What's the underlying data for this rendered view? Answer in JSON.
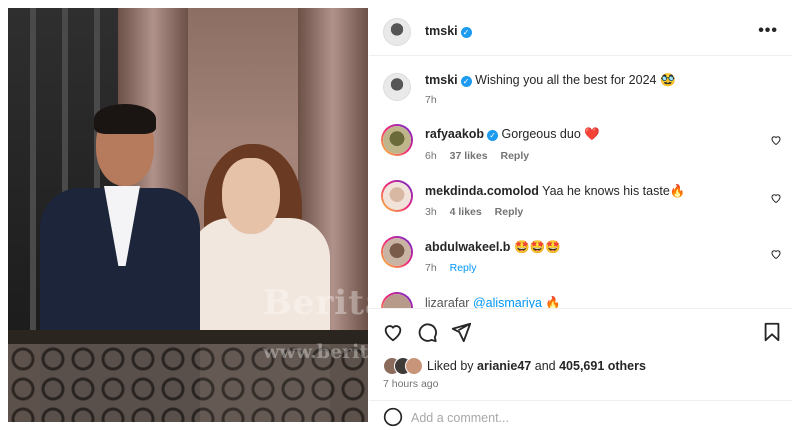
{
  "post": {
    "author": "tmski",
    "verified": true
  },
  "caption": {
    "username": "tmski",
    "text": "Wishing you all the best for 2024",
    "emoji": "🥸",
    "time": "7h"
  },
  "comments": [
    {
      "username": "rafyaakob",
      "verified": true,
      "text": "Gorgeous duo",
      "emoji": "❤️",
      "time": "6h",
      "likes": "37 likes",
      "reply": "Reply"
    },
    {
      "username": "mekdinda.comolod",
      "verified": false,
      "text": "Yaa he knows his taste",
      "emoji": "🔥",
      "time": "3h",
      "likes": "4 likes",
      "reply": "Reply"
    },
    {
      "username": "abdulwakeel.b",
      "verified": false,
      "text": "",
      "emoji": "🤩🤩🤩",
      "time": "7h",
      "likes": "",
      "reply": "Reply"
    },
    {
      "username": "lizarafar",
      "verified": false,
      "text": "@alismariya",
      "emoji": "🔥",
      "time": "",
      "likes": "",
      "reply": ""
    }
  ],
  "engagement": {
    "liked_by_prefix": "Liked by",
    "liked_by_user": "arianie47",
    "and": "and",
    "others_count": "405,691 others",
    "time_ago": "7 hours ago"
  },
  "add_comment": {
    "placeholder": "Add a comment..."
  },
  "photo": {
    "watermark": "BeritaKopak",
    "watermark_url": "www.beritakopak.com"
  },
  "icons": {
    "more": "more-options-icon",
    "like": "heart-icon",
    "comment": "comment-icon",
    "share": "send-icon",
    "save": "bookmark-icon",
    "emoji": "emoji-icon"
  },
  "colors": {
    "verified": "#1d9bf0",
    "heart_red": "#ed4956",
    "muted": "#737373",
    "link_blue": "#0095f6"
  }
}
